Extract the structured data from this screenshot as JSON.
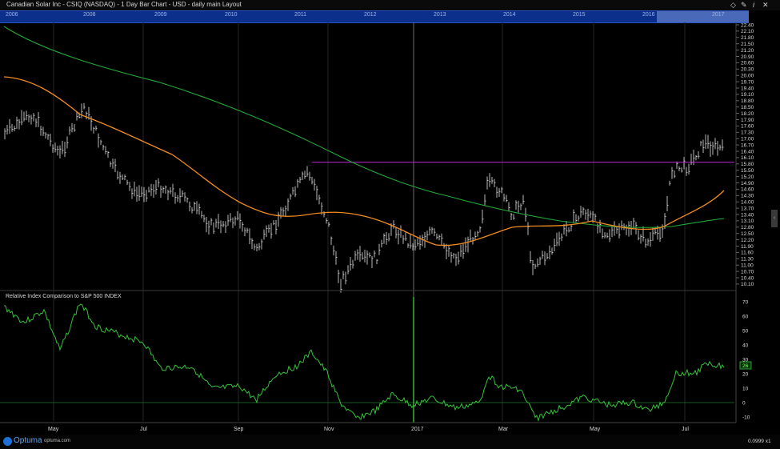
{
  "window": {
    "title": "Canadian Solar Inc - CSIQ (NASDAQ) - 1 Day Bar Chart - USD - daily main Layout",
    "icons": [
      "diamond-icon",
      "pin-icon",
      "info-icon",
      "close-icon"
    ],
    "icon_glyphs": [
      "◇",
      "✎",
      "i",
      "✕"
    ]
  },
  "navigator": {
    "years": [
      "2006",
      "2008",
      "2009",
      "2010",
      "2011",
      "2012",
      "2013",
      "2014",
      "2015",
      "2016",
      "2017"
    ]
  },
  "price_panel": {
    "y_ticks": [
      "22.40",
      "22.10",
      "21.80",
      "21.50",
      "21.20",
      "20.90",
      "20.60",
      "20.30",
      "20.00",
      "19.70",
      "19.40",
      "19.10",
      "18.80",
      "18.50",
      "18.20",
      "17.90",
      "17.60",
      "17.30",
      "17.00",
      "16.70",
      "16.40",
      "16.10",
      "15.80",
      "15.50",
      "15.20",
      "14.90",
      "14.60",
      "14.30",
      "14.00",
      "13.70",
      "13.40",
      "13.10",
      "12.80",
      "12.50",
      "12.20",
      "11.90",
      "11.60",
      "11.30",
      "11.00",
      "10.70",
      "10.40",
      "10.10"
    ],
    "resistance_level": 15.88,
    "colors": {
      "bars": "#e6e6e6",
      "ma_fast": "#f28c1f",
      "ma_slow": "#22a83a",
      "resistance": "#c02ad6"
    }
  },
  "indicator_panel": {
    "title": "Relative Index Comparison to S&P 500 INDEX",
    "y_ticks": [
      "70",
      "60",
      "50",
      "40",
      "30",
      "20",
      "10",
      "0",
      "-10"
    ],
    "current_value": "26",
    "color": "#36c23a"
  },
  "x_axis": {
    "labels": [
      "May",
      "Jul",
      "Sep",
      "Nov",
      "2017",
      "Mar",
      "May",
      "Jul"
    ]
  },
  "footer": {
    "brand": "Optuma",
    "url": "optuma.com",
    "zoom_readout": "0.0999",
    "zoom_suffix": "x1"
  },
  "side_tab_glyph": "‹"
}
